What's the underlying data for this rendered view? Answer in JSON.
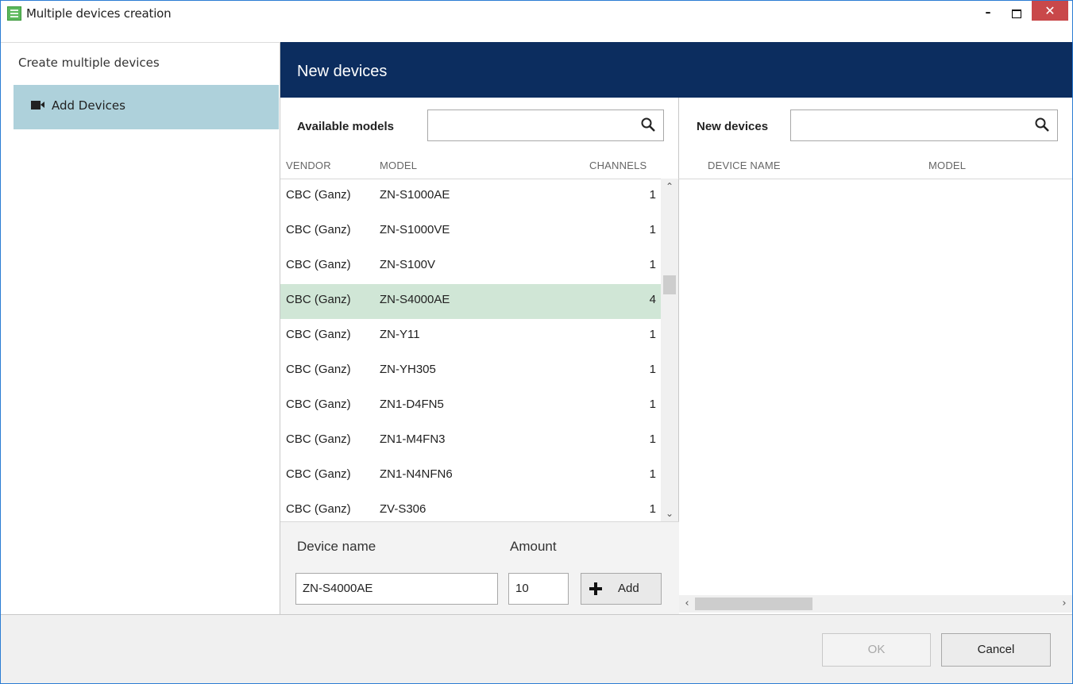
{
  "window": {
    "title": "Multiple devices creation",
    "close_glyph": "✕",
    "minimize_glyph": "–"
  },
  "sidebar": {
    "header": "Create multiple devices",
    "items": [
      {
        "label": "Add Devices",
        "icon": "camera-icon",
        "selected": true
      }
    ]
  },
  "main": {
    "title": "New devices"
  },
  "available": {
    "label": "Available models",
    "search_value": "",
    "columns": {
      "vendor": "VENDOR",
      "model": "MODEL",
      "channels": "CHANNELS"
    },
    "rows": [
      {
        "vendor": "CBC (Ganz)",
        "model": "ZN-S1000AE",
        "channels": "1"
      },
      {
        "vendor": "CBC (Ganz)",
        "model": "ZN-S1000VE",
        "channels": "1"
      },
      {
        "vendor": "CBC (Ganz)",
        "model": "ZN-S100V",
        "channels": "1"
      },
      {
        "vendor": "CBC (Ganz)",
        "model": "ZN-S4000AE",
        "channels": "4"
      },
      {
        "vendor": "CBC (Ganz)",
        "model": "ZN-Y11",
        "channels": "1"
      },
      {
        "vendor": "CBC (Ganz)",
        "model": "ZN-YH305",
        "channels": "1"
      },
      {
        "vendor": "CBC (Ganz)",
        "model": "ZN1-D4FN5",
        "channels": "1"
      },
      {
        "vendor": "CBC (Ganz)",
        "model": "ZN1-M4FN3",
        "channels": "1"
      },
      {
        "vendor": "CBC (Ganz)",
        "model": "ZN1-N4NFN6",
        "channels": "1"
      },
      {
        "vendor": "CBC (Ganz)",
        "model": "ZV-S306",
        "channels": "1"
      }
    ],
    "selected_index": 3
  },
  "form": {
    "device_name_label": "Device name",
    "device_name_value": "ZN-S4000AE",
    "amount_label": "Amount",
    "amount_value": "10",
    "add_label": "Add"
  },
  "new_devices": {
    "label": "New devices",
    "search_value": "",
    "columns": {
      "device_name": "DEVICE NAME",
      "model": "MODEL"
    },
    "rows": []
  },
  "footer": {
    "ok_label": "OK",
    "ok_enabled": false,
    "cancel_label": "Cancel"
  },
  "colors": {
    "header_bg": "#0c2d5f",
    "nav_selected": "#aed1db",
    "row_selected": "#d0e6d6",
    "close_button": "#c9484a"
  }
}
